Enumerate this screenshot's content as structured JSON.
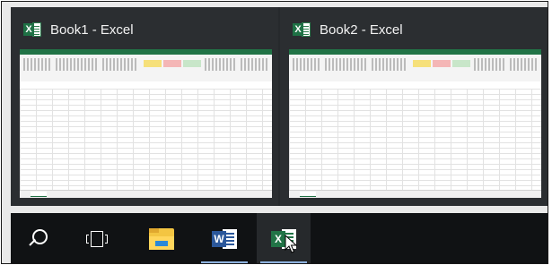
{
  "windows": [
    {
      "app_icon": "excel-icon",
      "app_letter": "X",
      "title": "Book1 - Excel"
    },
    {
      "app_icon": "excel-icon",
      "app_letter": "X",
      "title": "Book2 - Excel"
    }
  ],
  "taskbar": {
    "items": [
      {
        "name": "search",
        "icon": "search-icon",
        "active": false
      },
      {
        "name": "task-view",
        "icon": "task-view-icon",
        "active": false
      },
      {
        "name": "file-explorer",
        "icon": "folder-icon",
        "active": false
      },
      {
        "name": "word",
        "icon": "word-icon",
        "letter": "W",
        "running": true,
        "active": false
      },
      {
        "name": "excel",
        "icon": "excel-icon",
        "letter": "X",
        "running": true,
        "active": true
      }
    ]
  },
  "colors": {
    "excel_green": "#217346",
    "word_blue": "#2b579a",
    "taskbar_bg": "#101214",
    "preview_bg": "#26292c",
    "running_indicator": "#8fb3e0"
  }
}
